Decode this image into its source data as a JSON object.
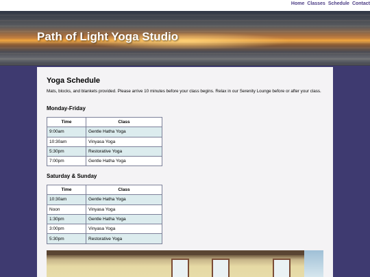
{
  "nav": {
    "links": [
      "Home",
      "Classes",
      "Schedule",
      "Contact"
    ]
  },
  "site": {
    "title": "Path of Light Yoga Studio"
  },
  "page": {
    "heading": "Yoga Schedule",
    "intro": "Mats, blocks, and blankets provided. Please arrive 10 minutes before your class begins. Relax in our Serenity Lounge before or after your class."
  },
  "schedules": [
    {
      "heading": "Monday-Friday",
      "columns": [
        "Time",
        "Class"
      ],
      "rows": [
        [
          "9:00am",
          "Gentle Hatha Yoga"
        ],
        [
          "10:30am",
          "Vinyasa Yoga"
        ],
        [
          "5:30pm",
          "Restorative Yoga"
        ],
        [
          "7:00pm",
          "Gentle Hatha Yoga"
        ]
      ]
    },
    {
      "heading": "Saturday & Sunday",
      "columns": [
        "Time",
        "Class"
      ],
      "rows": [
        [
          "10:30am",
          "Gentle Hatha Yoga"
        ],
        [
          "Noon",
          "Vinyasa Yoga"
        ],
        [
          "1:30pm",
          "Gentle Hatha Yoga"
        ],
        [
          "3:00pm",
          "Vinyasa Yoga"
        ],
        [
          "5:30pm",
          "Restorative Yoga"
        ]
      ]
    }
  ],
  "colors": {
    "page_background": "#3e3a70",
    "nav_link": "#4a3b84",
    "row_alt": "#dcecee",
    "content_background": "#f4f3f5"
  }
}
